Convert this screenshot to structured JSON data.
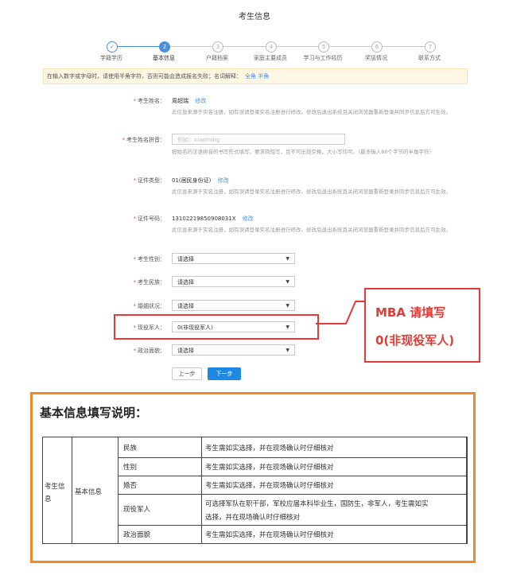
{
  "page": {
    "title": "考生信息"
  },
  "steps": [
    {
      "num": "✓",
      "label": "学籍学历",
      "state": "done"
    },
    {
      "num": "2",
      "label": "基本信息",
      "state": "current"
    },
    {
      "num": "3",
      "label": "户籍档案",
      "state": "todo"
    },
    {
      "num": "4",
      "label": "家庭主要成员",
      "state": "todo"
    },
    {
      "num": "5",
      "label": "学习与工作经历",
      "state": "todo"
    },
    {
      "num": "6",
      "label": "奖惩情况",
      "state": "todo"
    },
    {
      "num": "7",
      "label": "联系方式",
      "state": "todo"
    }
  ],
  "notice": {
    "text": "在输入数字或字母时，请使用半角字符，否则可能会造成报名失败；名词解释：",
    "link": "全角 半角"
  },
  "form": {
    "name": {
      "label": "考生姓名：",
      "value": "周超瑞",
      "edit": "修改",
      "note": "此信息来源于实名注册，如有误请登录实名注册进行修改。修改后退出系统且关闭浏览器重新登录并同步信息后方可生效。"
    },
    "pinyin": {
      "label": "考生姓名拼音：",
      "placeholder": "例如：xiaoming",
      "note": "按姓名的汉语拼音的书写形式填写，要求简短写，且不可出现空格，大小写均可。（最多输入80个字节的半角字符）"
    },
    "idtype": {
      "label": "证件类型：",
      "value": "01(居民身份证)",
      "edit": "修改",
      "note": "此信息来源于实名注册，如有误请登录实名注册进行修改。修改后退出系统且关闭浏览器重新登录并同步信息后方可生效。"
    },
    "idnum": {
      "label": "证件号码：",
      "value": "13102219850908031X",
      "edit": "修改",
      "note": "此信息来源于实名注册，如有误请登录实名注册进行修改。修改后退出系统且关闭浏览器重新登录并同步信息后方可生效。"
    },
    "gender": {
      "label": "考生性别：",
      "value": "请选择"
    },
    "ethnic": {
      "label": "考生民族：",
      "value": "请选择"
    },
    "marital": {
      "label": "婚姻状况：",
      "value": "请选择"
    },
    "military": {
      "label": "现役军人：",
      "value": "0(非现役军人)"
    },
    "political": {
      "label": "政治面貌：",
      "value": "请选择"
    }
  },
  "buttons": {
    "prev": "上一步",
    "next": "下一步"
  },
  "callout": {
    "line1": "MBA 请填写",
    "line2": "0(非现役军人)"
  },
  "explain": {
    "title": "基本信息填写说明：",
    "col1": "考生信息",
    "col2": "基本信息",
    "rows": [
      {
        "item": "民族",
        "desc": "考生需如实选择，并在现场确认时仔细核对"
      },
      {
        "item": "性别",
        "desc": "考生需如实选择，并在现场确认时仔细核对"
      },
      {
        "item": "婚否",
        "desc": "考生需如实选择，并在现场确认时仔细核对"
      },
      {
        "item": "现役军人",
        "desc1": "可选择军队在职干部，军校应届本科毕业生，国防生，非军人，考生需如实",
        "desc2": "选择，并在现场确认时仔细核对"
      },
      {
        "item": "政治面貌",
        "desc": "考生需如实选择，并在现场确认时仔细核对"
      }
    ]
  },
  "colors": {
    "accent": "#1e88e5",
    "callout": "#e53935",
    "frame": "#f08a24"
  }
}
